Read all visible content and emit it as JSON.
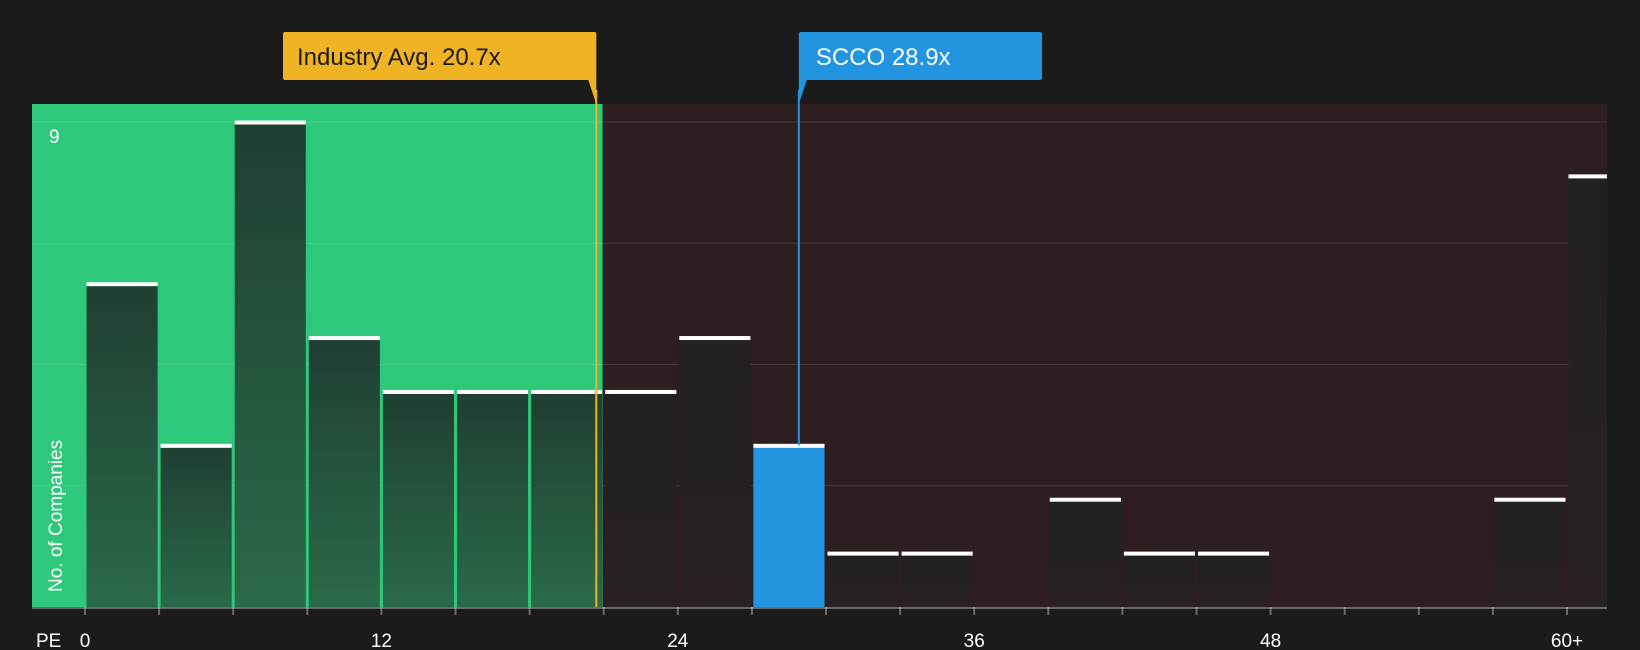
{
  "chart_data": {
    "type": "bar",
    "x_axis_label": "PE",
    "y_axis_label": "No. of Companies",
    "y_tick_label": "9",
    "x_ticks": [
      {
        "value": 0,
        "label": "0"
      },
      {
        "value": 12,
        "label": "12"
      },
      {
        "value": 24,
        "label": "24"
      },
      {
        "value": 36,
        "label": "36"
      },
      {
        "value": 48,
        "label": "48"
      },
      {
        "value": 60,
        "label": "60+"
      }
    ],
    "ylim": [
      0,
      9
    ],
    "bin_width": 3,
    "bins": [
      {
        "start": 0,
        "value": 6
      },
      {
        "start": 3,
        "value": 3
      },
      {
        "start": 6,
        "value": 9
      },
      {
        "start": 9,
        "value": 5
      },
      {
        "start": 12,
        "value": 4
      },
      {
        "start": 15,
        "value": 4
      },
      {
        "start": 18,
        "value": 4
      },
      {
        "start": 21,
        "value": 4
      },
      {
        "start": 24,
        "value": 5
      },
      {
        "start": 27,
        "value": 3,
        "highlight": true
      },
      {
        "start": 30,
        "value": 1
      },
      {
        "start": 33,
        "value": 1
      },
      {
        "start": 39,
        "value": 2
      },
      {
        "start": 42,
        "value": 1
      },
      {
        "start": 45,
        "value": 1
      },
      {
        "start": 57,
        "value": 2
      },
      {
        "start": 60,
        "value": 8
      }
    ],
    "industry_avg": {
      "value": 20.7,
      "label": "Industry Avg. 20.7x"
    },
    "company": {
      "value": 28.9,
      "label": "SCCO 28.9x"
    },
    "colors": {
      "background": "#1b1b1b",
      "green_zone": "#2ec87a",
      "red_zone": "#2e1e1f",
      "bar_green": "#234836",
      "bar_dark": "#242121",
      "highlight": "#2394e0",
      "industry": "#f0b323",
      "cap": "#ffffff"
    }
  }
}
